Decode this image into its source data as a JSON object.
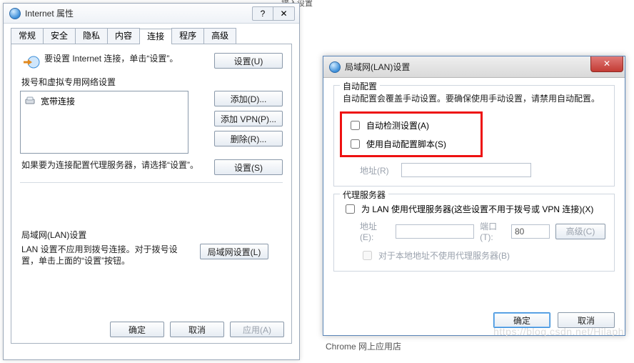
{
  "ip": {
    "title": "Internet 属性",
    "help_icon": "?",
    "close_icon": "✕",
    "tabs": [
      "常规",
      "安全",
      "隐私",
      "内容",
      "连接",
      "程序",
      "高级"
    ],
    "active_tab_index": 4,
    "conn": {
      "intro": "要设置 Internet 连接，单击“设置”。",
      "setup_btn": "设置(U)",
      "dial_section": "拨号和虚拟专用网络设置",
      "dial_item": "宽带连接",
      "add_btn": "添加(D)...",
      "add_vpn_btn": "添加 VPN(P)...",
      "remove_btn": "删除(R)...",
      "proxy_note": "如果要为连接配置代理服务器，请选择“设置”。",
      "proxy_btn": "设置(S)",
      "lan_section": "局域网(LAN)设置",
      "lan_note": "LAN 设置不应用到拨号连接。对于拨号设置，单击上面的“设置”按钮。",
      "lan_btn": "局域网设置(L)"
    },
    "footer_ok": "确定",
    "footer_cancel": "取消",
    "footer_apply": "应用(A)"
  },
  "lan": {
    "title": "局域网(LAN)设置",
    "close_icon": "✕",
    "auto_legend": "自动配置",
    "auto_note": "自动配置会覆盖手动设置。要确保使用手动设置，请禁用自动配置。",
    "auto_detect": "自动检测设置(A)",
    "auto_script": "使用自动配置脚本(S)",
    "addr_label": "地址(R)",
    "proxy_legend": "代理服务器",
    "proxy_use": "为 LAN 使用代理服务器(这些设置不用于拨号或 VPN 连接)(X)",
    "addr2_label": "地址(E):",
    "port_label": "端口(T):",
    "port_value": "80",
    "adv_btn": "高级(C)",
    "bypass_local": "对于本地地址不使用代理服务器(B)",
    "ok": "确定",
    "cancel": "取消"
  },
  "bg": {
    "chrome_store": "Chrome 网上应用店",
    "fragment": "接入设置",
    "watermark": "https://blog.csdn.net/Hilaph"
  }
}
